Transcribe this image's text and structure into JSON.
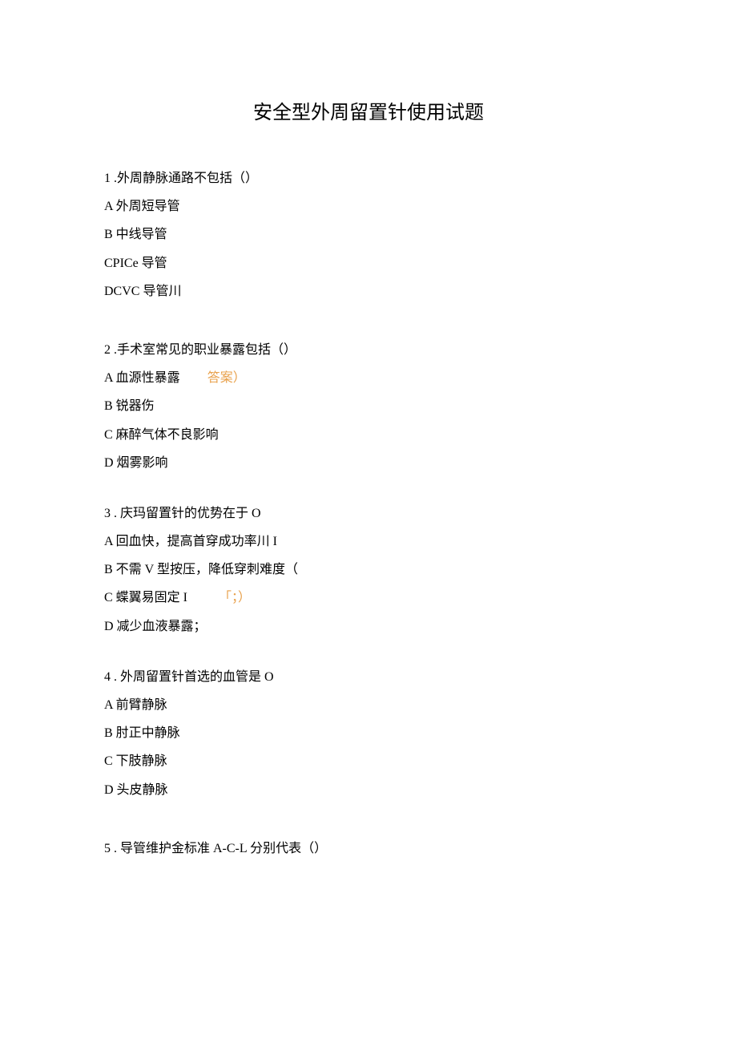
{
  "title": "安全型外周留置针使用试题",
  "q1": {
    "question": "1 .外周静脉通路不包括（）",
    "optA": "A 外周短导管",
    "optB": "B 中线导管",
    "optC": "CPICe 导管",
    "optD": "DCVC 导管川"
  },
  "q2": {
    "question": "2  .手术室常见的职业暴露包括（）",
    "optA": "A 血源性暴露",
    "optA_answer": "答案）",
    "optB": "B 锐器伤",
    "optC": "C 麻醉气体不良影响",
    "optD": "D 烟雾影响"
  },
  "q3": {
    "question": "3  . 庆玛留置针的优势在于 O",
    "optA": "A 回血快，提高首穿成功率川 I",
    "optB": "B 不需 V 型按压，降低穿刺难度（",
    "optC": "C 蝶翼易固定 I",
    "optC_answer": "「；）",
    "optD": "D 减少血液暴露；"
  },
  "q4": {
    "question": "4  . 外周留置针首选的血管是 O",
    "optA": "A 前臂静脉",
    "optB": "B 肘正中静脉",
    "optC": "C 下肢静脉",
    "optD": "D 头皮静脉"
  },
  "q5": {
    "question": "5  . 导管维护金标准 A-C-L 分别代表（）"
  }
}
